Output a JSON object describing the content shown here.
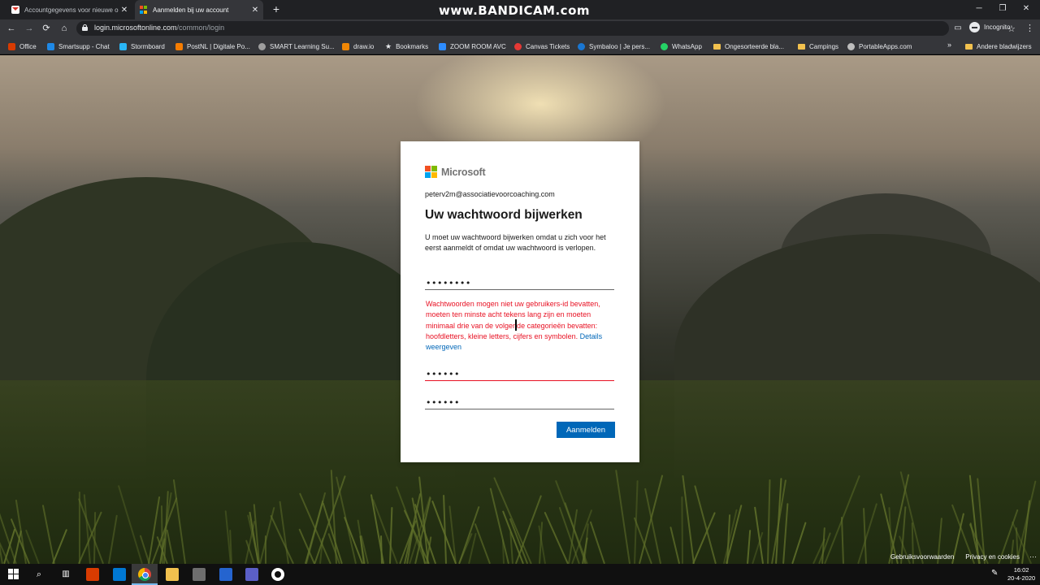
{
  "browser": {
    "tabs": [
      {
        "title": "Accountgegevens voor nieuwe o",
        "close": "✕"
      },
      {
        "title": "Aanmelden bij uw account",
        "close": "✕"
      }
    ],
    "new_tab": "+",
    "watermark": "www.BANDICAM.com",
    "window_controls": {
      "minimize": "─",
      "maximize": "❐",
      "close": "✕"
    },
    "nav": {
      "back": "←",
      "forward": "→",
      "reload": "⟳",
      "home": "⌂"
    },
    "url_host": "login.microsoftonline.com",
    "url_path": "/common/login",
    "star": "☆",
    "profile_label": "Incognito",
    "menu": "⋮",
    "bookmarks": [
      {
        "label": "Office",
        "color": "#d83b01"
      },
      {
        "label": "Smartsupp - Chat",
        "color": "#1e88e5"
      },
      {
        "label": "Stormboard",
        "color": "#29b6f6"
      },
      {
        "label": "PostNL | Digitale Po...",
        "color": "#f57c00"
      },
      {
        "label": "SMART Learning Su...",
        "color": "#9e9e9e"
      },
      {
        "label": "draw.io",
        "color": "#f08705"
      },
      {
        "label": "Bookmarks",
        "color": "#e8eaed"
      },
      {
        "label": "ZOOM ROOM AVC",
        "color": "#2d8cff"
      },
      {
        "label": "Canvas Tickets",
        "color": "#e53935"
      },
      {
        "label": "Symbaloo | Je pers...",
        "color": "#1976d2"
      },
      {
        "label": "WhatsApp",
        "color": "#25d366"
      },
      {
        "label": "Ongesorteerde bla...",
        "color": "#f2c14e"
      },
      {
        "label": "Campings",
        "color": "#f2c14e"
      },
      {
        "label": "PortableApps.com",
        "color": "#bdbdbd"
      }
    ],
    "bookmarks_more": "»",
    "other_bookmarks": "Andere bladwijzers"
  },
  "signin": {
    "brand": "Microsoft",
    "brand_colors": [
      "#f25022",
      "#7fba00",
      "#00a4ef",
      "#ffb900"
    ],
    "identity": "peterv2m@associatievoorcoaching.com",
    "title": "Uw wachtwoord bijwerken",
    "description": "U moet uw wachtwoord bijwerken omdat u zich voor het eerst aanmeldt of omdat uw wachtwoord is verlopen.",
    "current_password": "••••••••",
    "error_text": "Wachtwoorden mogen niet uw gebruikers-id bevatten, moeten ten minste acht tekens lang zijn en moeten minimaal drie van de volgende categorieën bevatten: hoofdletters, kleine letters, cijfers en symbolen.",
    "error_link": "Details weergeven",
    "new_password": "••••••",
    "confirm_password": "••••••",
    "submit": "Aanmelden",
    "accent": "#0067b8",
    "error_color": "#e81123"
  },
  "footer": {
    "terms": "Gebruiksvoorwaarden",
    "privacy": "Privacy en cookies",
    "more": "···"
  },
  "taskbar": {
    "time": "16:02",
    "date": "20-4-2020"
  }
}
